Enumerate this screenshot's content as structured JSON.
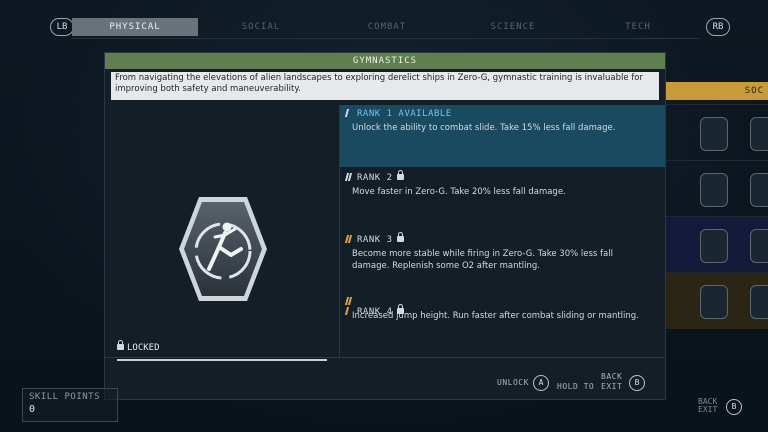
{
  "tabs": {
    "left_button": "LB",
    "right_button": "RB",
    "items": [
      {
        "label": "PHYSICAL",
        "active": true
      },
      {
        "label": "SOCIAL",
        "active": false
      },
      {
        "label": "COMBAT",
        "active": false
      },
      {
        "label": "SCIENCE",
        "active": false
      },
      {
        "label": "TECH",
        "active": false
      }
    ]
  },
  "side_column": {
    "header": "SOC"
  },
  "skill": {
    "title": "GYMNASTICS",
    "description": "From navigating the elevations of alien landscapes to exploring derelict ships in Zero-G, gymnastic training is invaluable for improving both safety and maneuverability.",
    "icon": "gymnast-kick-badge-icon",
    "status": "LOCKED",
    "ranks": [
      {
        "head": "RANK 1 AVAILABLE",
        "text": "Unlock the ability to combat slide. Take 15% less fall damage.",
        "locked": false,
        "selected": true
      },
      {
        "head": "RANK 2",
        "text": "Move faster in Zero-G. Take 20% less fall damage.",
        "locked": true,
        "selected": false
      },
      {
        "head": "RANK 3",
        "text": "Become more stable while firing in Zero-G. Take 30% less fall damage. Replenish some O2 after mantling.",
        "locked": true,
        "selected": false
      },
      {
        "head": "RANK 4",
        "text": "Increased jump height. Run faster after combat sliding or mantling.",
        "locked": true,
        "selected": false
      }
    ]
  },
  "footer": {
    "unlock_label": "UNLOCK",
    "unlock_button": "A",
    "hold_label": "HOLD TO",
    "back_label": "BACK",
    "exit_label": "EXIT",
    "back_button": "B"
  },
  "skill_points": {
    "label": "SKILL POINTS",
    "value": "0"
  },
  "bottom_right": {
    "back": "BACK",
    "exit": "EXIT",
    "button": "B"
  },
  "colors": {
    "accent_blue": "#69c6f0",
    "title_green": "#5f7f4e",
    "selected_row": "#1a4a60",
    "tier_gold": "#c79b38"
  }
}
